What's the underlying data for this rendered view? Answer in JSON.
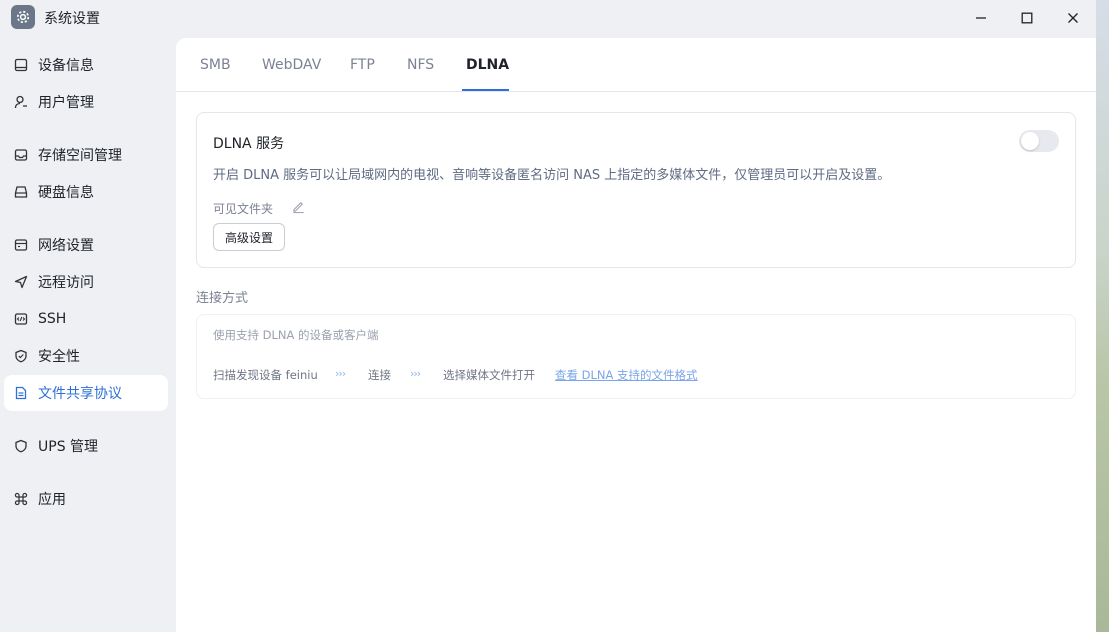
{
  "window": {
    "title": "系统设置",
    "app_icon": "gear-icon",
    "controls": [
      "minimize-icon",
      "maximize-icon",
      "close-icon"
    ]
  },
  "sidebar": {
    "items": [
      {
        "label": "设备信息",
        "icon": "device-icon"
      },
      {
        "label": "用户管理",
        "icon": "user-icon"
      },
      {
        "label": "存储空间管理",
        "icon": "storage-icon"
      },
      {
        "label": "硬盘信息",
        "icon": "disk-icon"
      },
      {
        "label": "网络设置",
        "icon": "network-icon"
      },
      {
        "label": "远程访问",
        "icon": "send-icon"
      },
      {
        "label": "SSH",
        "icon": "code-icon"
      },
      {
        "label": "安全性",
        "icon": "shield-check-icon"
      },
      {
        "label": "文件共享协议",
        "icon": "document-icon",
        "active": true
      },
      {
        "label": "UPS 管理",
        "icon": "shield-icon"
      },
      {
        "label": "应用",
        "icon": "command-icon"
      }
    ]
  },
  "tabs": [
    {
      "label": "SMB"
    },
    {
      "label": "WebDAV"
    },
    {
      "label": "FTP"
    },
    {
      "label": "NFS"
    },
    {
      "label": "DLNA",
      "active": true
    }
  ],
  "dlna_card": {
    "title": "DLNA 服务",
    "enabled": false,
    "description": "开启 DLNA 服务可以让局域网内的电视、音响等设备匿名访问 NAS 上指定的多媒体文件，仅管理员可以开启及设置。",
    "visible_folder_label": "可见文件夹",
    "advanced_button": "高级设置"
  },
  "connection": {
    "title": "连接方式",
    "subtitle": "使用支持 DLNA 的设备或客户端",
    "steps": [
      "扫描发现设备 feiniu",
      "连接",
      "选择媒体文件打开"
    ],
    "arrow": "›››",
    "link": "查看 DLNA 支持的文件格式"
  },
  "colors": {
    "accent": "#2e6fd8",
    "sidebar_bg": "#eef0f4",
    "panel_bg": "#ffffff"
  }
}
